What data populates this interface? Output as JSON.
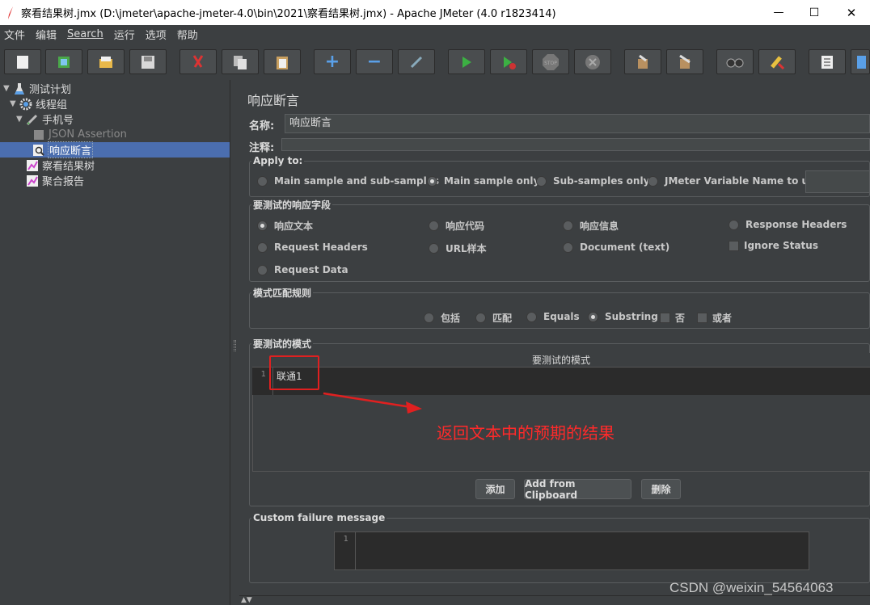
{
  "window": {
    "title": "察看结果树.jmx (D:\\jmeter\\apache-jmeter-4.0\\bin\\2021\\察看结果树.jmx) - Apache JMeter (4.0 r1823414)",
    "minimize_glyph": "—",
    "maximize_glyph": "☐",
    "close_glyph": "✕"
  },
  "menu": [
    "文件",
    "编辑",
    "Search",
    "运行",
    "选项",
    "帮助"
  ],
  "toolbar": {
    "icons": [
      "new-icon",
      "templates-icon",
      "open-icon",
      "save-icon",
      "cut-icon",
      "copy-icon",
      "paste-icon",
      "expand-icon",
      "collapse-icon",
      "toggle-icon",
      "start-icon",
      "start-no-pause-icon",
      "stop-icon",
      "shutdown-icon",
      "clear-icon",
      "clear-all-icon",
      "search-icon",
      "reset-search-icon",
      "function-helper-icon",
      "help-icon"
    ],
    "expand_glyph": "+",
    "collapse_glyph": "−",
    "stop_label": "STOP"
  },
  "tree": {
    "items": [
      {
        "label": "测试计划",
        "icon": "test-plan-icon"
      },
      {
        "label": "线程组",
        "icon": "thread-group-gear-icon"
      },
      {
        "label": "手机号",
        "icon": "sampler-pen-icon"
      },
      {
        "label": "JSON Assertion",
        "icon": "assertion-icon",
        "disabled": true
      },
      {
        "label": "响应断言",
        "icon": "assertion-icon",
        "selected": true
      },
      {
        "label": "察看结果树",
        "icon": "listener-icon"
      },
      {
        "label": "聚合报告",
        "icon": "listener-icon"
      }
    ]
  },
  "panel": {
    "title": "响应断言",
    "name_label": "名称:",
    "name_value": "响应断言",
    "comment_label": "注释:",
    "comment_value": "",
    "apply_to": {
      "legend": "Apply to:",
      "options": [
        "Main sample and sub-samples",
        "Main sample only",
        "Sub-samples only",
        "JMeter Variable Name to use"
      ],
      "selected": "Main sample only"
    },
    "field": {
      "legend": "要测试的响应字段",
      "options": [
        "响应文本",
        "响应代码",
        "响应信息",
        "Response Headers",
        "Request Headers",
        "URL样本",
        "Document (text)",
        "Ignore Status",
        "Request Data"
      ],
      "selected": "响应文本"
    },
    "match_rules": {
      "legend": "模式匹配规则",
      "options": [
        "包括",
        "匹配",
        "Equals",
        "Substring",
        "否",
        "或者"
      ],
      "selected": "Substring"
    },
    "patterns": {
      "legend": "要测试的模式",
      "column_header": "要测试的模式",
      "rows": [
        "联通1"
      ],
      "line_number": "1"
    },
    "buttons": {
      "add": "添加",
      "add_clipboard": "Add from Clipboard",
      "delete": "删除"
    },
    "custom_failure": {
      "legend": "Custom failure message",
      "line_number": "1",
      "value": ""
    }
  },
  "annotation": {
    "text": "返回文本中的预期的结果",
    "color": "#e02020"
  },
  "watermark": "CSDN @weixin_54564063",
  "colors": {
    "background": "#3c3f41",
    "selection": "#4b6eaf",
    "editor": "#2b2b2b"
  }
}
